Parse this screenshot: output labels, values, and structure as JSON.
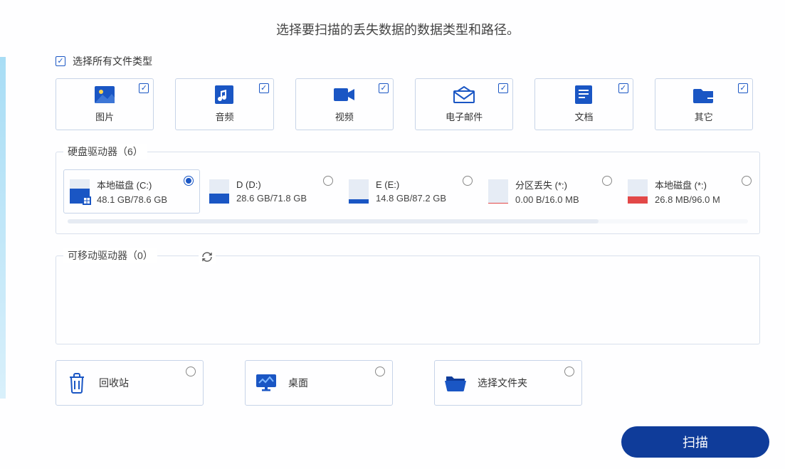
{
  "title": "选择要扫描的丢失数据的数据类型和路径。",
  "select_all": {
    "label": "选择所有文件类型",
    "checked": true
  },
  "types": [
    {
      "key": "image",
      "label": "图片",
      "checked": true
    },
    {
      "key": "audio",
      "label": "音频",
      "checked": true
    },
    {
      "key": "video",
      "label": "视频",
      "checked": true
    },
    {
      "key": "email",
      "label": "电子邮件",
      "checked": true
    },
    {
      "key": "doc",
      "label": "文档",
      "checked": true
    },
    {
      "key": "other",
      "label": "其它",
      "checked": true
    }
  ],
  "drives_group": {
    "legend": "硬盘驱动器（6）",
    "selected_index": 0,
    "drives": [
      {
        "name": "本地磁盘 (C:)",
        "size": "48.1 GB/78.6 GB",
        "fill": 0.62,
        "color": "#1a56c4",
        "win": true
      },
      {
        "name": "D (D:)",
        "size": "28.6 GB/71.8 GB",
        "fill": 0.4,
        "color": "#1a56c4",
        "win": false
      },
      {
        "name": "E (E:)",
        "size": "14.8 GB/87.2 GB",
        "fill": 0.17,
        "color": "#1a56c4",
        "win": false
      },
      {
        "name": "分区丢失 (*:)",
        "size": "0.00  B/16.0 MB",
        "fill": 0.02,
        "color": "#e24848",
        "win": false
      },
      {
        "name": "本地磁盘 (*:)",
        "size": "26.8 MB/96.0 M",
        "fill": 0.3,
        "color": "#e24848",
        "win": false
      }
    ]
  },
  "removable_group": {
    "legend": "可移动驱动器（0）"
  },
  "locations": [
    {
      "key": "recycle",
      "label": "回收站"
    },
    {
      "key": "desktop",
      "label": "桌面"
    },
    {
      "key": "folder",
      "label": "选择文件夹"
    }
  ],
  "scan_label": "扫描"
}
